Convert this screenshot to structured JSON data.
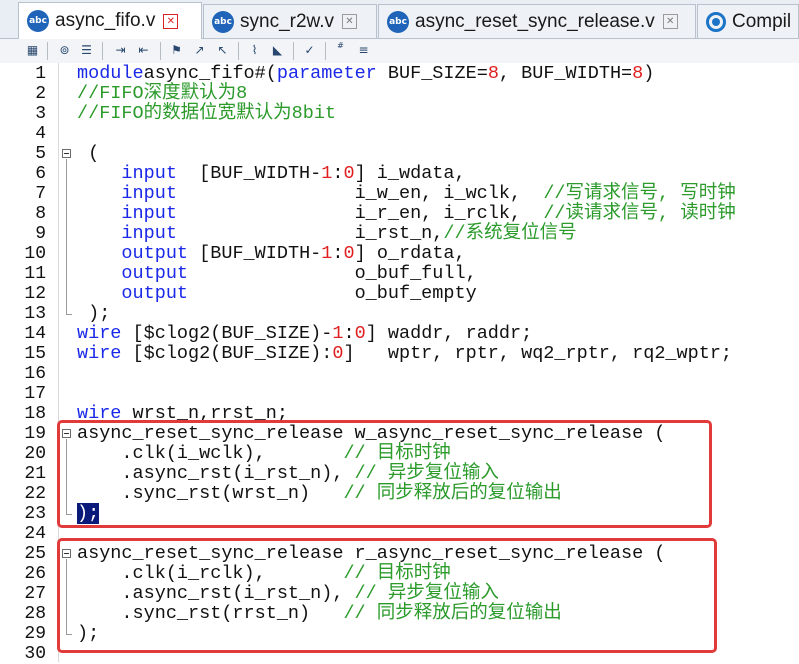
{
  "tabs": [
    {
      "label": "async_fifo.v",
      "icon": "abc-file-icon",
      "icon_text": "abc",
      "active": true
    },
    {
      "label": "sync_r2w.v",
      "icon": "abc-file-icon",
      "icon_text": "abc",
      "active": false
    },
    {
      "label": "async_reset_sync_release.v",
      "icon": "abc-file-icon",
      "icon_text": "abc",
      "active": false
    },
    {
      "label": "Compil",
      "icon": "compile-icon",
      "active": false
    }
  ],
  "colors": {
    "keyword": "#1a28e8",
    "number": "#e02020",
    "comment": "#2c9b2c",
    "selection": "#0a1a7a",
    "highlight_box": "#e03a3a"
  },
  "editor": {
    "lines": [
      {
        "n": "1",
        "code": [
          [
            "kw",
            "module"
          ],
          [
            "",
            "async_fifo#("
          ],
          [
            "kw",
            "parameter"
          ],
          [
            "",
            " BUF_SIZE="
          ],
          [
            "num",
            "8"
          ],
          [
            "",
            ", BUF_WIDTH="
          ],
          [
            "num",
            "8"
          ],
          [
            "",
            ")"
          ]
        ]
      },
      {
        "n": "2",
        "code": [
          [
            "cm",
            "//FIFO深度默认为8"
          ]
        ]
      },
      {
        "n": "3",
        "code": [
          [
            "cm",
            "//FIFO的数据位宽默认为8bit"
          ]
        ]
      },
      {
        "n": "4",
        "code": []
      },
      {
        "n": "5",
        "code": [
          [
            "",
            " ("
          ]
        ],
        "fold": true
      },
      {
        "n": "6",
        "code": [
          [
            "",
            "    "
          ],
          [
            "kw",
            "input"
          ],
          [
            "",
            "  [BUF_WIDTH-"
          ],
          [
            "num",
            "1"
          ],
          [
            "",
            ":"
          ],
          [
            "num",
            "0"
          ],
          [
            "",
            "] i_wdata,"
          ]
        ]
      },
      {
        "n": "7",
        "code": [
          [
            "",
            "    "
          ],
          [
            "kw",
            "input"
          ],
          [
            "",
            "                i_w_en, i_wclk,  "
          ],
          [
            "cm",
            "//写请求信号, 写时钟"
          ]
        ]
      },
      {
        "n": "8",
        "code": [
          [
            "",
            "    "
          ],
          [
            "kw",
            "input"
          ],
          [
            "",
            "                i_r_en, i_rclk,  "
          ],
          [
            "cm",
            "//读请求信号, 读时钟"
          ]
        ]
      },
      {
        "n": "9",
        "code": [
          [
            "",
            "    "
          ],
          [
            "kw",
            "input"
          ],
          [
            "",
            "                i_rst_n,"
          ],
          [
            "cm",
            "//系统复位信号"
          ]
        ]
      },
      {
        "n": "10",
        "code": [
          [
            "",
            "    "
          ],
          [
            "kw",
            "output"
          ],
          [
            "",
            " [BUF_WIDTH-"
          ],
          [
            "num",
            "1"
          ],
          [
            "",
            ":"
          ],
          [
            "num",
            "0"
          ],
          [
            "",
            "] o_rdata,"
          ]
        ]
      },
      {
        "n": "11",
        "code": [
          [
            "",
            "    "
          ],
          [
            "kw",
            "output"
          ],
          [
            "",
            "               o_buf_full,"
          ]
        ]
      },
      {
        "n": "12",
        "code": [
          [
            "",
            "    "
          ],
          [
            "kw",
            "output"
          ],
          [
            "",
            "               o_buf_empty"
          ]
        ]
      },
      {
        "n": "13",
        "code": [
          [
            "",
            " );"
          ]
        ]
      },
      {
        "n": "14",
        "code": [
          [
            "kw",
            "wire"
          ],
          [
            "",
            " [$clog2(BUF_SIZE)-"
          ],
          [
            "num",
            "1"
          ],
          [
            "",
            ":"
          ],
          [
            "num",
            "0"
          ],
          [
            "",
            "] waddr, raddr;"
          ]
        ]
      },
      {
        "n": "15",
        "code": [
          [
            "kw",
            "wire"
          ],
          [
            "",
            " [$clog2(BUF_SIZE):"
          ],
          [
            "num",
            "0"
          ],
          [
            "",
            "]   wptr, rptr, wq2_rptr, rq2_wptr;"
          ]
        ]
      },
      {
        "n": "16",
        "code": []
      },
      {
        "n": "17",
        "code": []
      },
      {
        "n": "18",
        "code": [
          [
            "kw",
            "wire"
          ],
          [
            "",
            " wrst_n,rrst_n;"
          ]
        ]
      },
      {
        "n": "19",
        "code": [
          [
            "",
            "async_reset_sync_release w_async_reset_sync_release ("
          ]
        ],
        "fold": true
      },
      {
        "n": "20",
        "code": [
          [
            "",
            "    .clk(i_wclk),       "
          ],
          [
            "cm",
            "// 目标时钟"
          ]
        ]
      },
      {
        "n": "21",
        "code": [
          [
            "",
            "    .async_rst(i_rst_n), "
          ],
          [
            "cm",
            "// 异步复位输入"
          ]
        ]
      },
      {
        "n": "22",
        "code": [
          [
            "",
            "    .sync_rst(wrst_n)   "
          ],
          [
            "cm",
            "// 同步释放后的复位输出"
          ]
        ]
      },
      {
        "n": "23",
        "code": [
          [
            "sel",
            ");"
          ]
        ]
      },
      {
        "n": "24",
        "code": []
      },
      {
        "n": "25",
        "code": [
          [
            "",
            "async_reset_sync_release r_async_reset_sync_release ("
          ]
        ],
        "fold": true
      },
      {
        "n": "26",
        "code": [
          [
            "",
            "    .clk(i_rclk),       "
          ],
          [
            "cm",
            "// 目标时钟"
          ]
        ]
      },
      {
        "n": "27",
        "code": [
          [
            "",
            "    .async_rst(i_rst_n), "
          ],
          [
            "cm",
            "// 异步复位输入"
          ]
        ]
      },
      {
        "n": "28",
        "code": [
          [
            "",
            "    .sync_rst(rrst_n)   "
          ],
          [
            "cm",
            "// 同步释放后的复位输出"
          ]
        ]
      },
      {
        "n": "29",
        "code": [
          [
            "",
            ");"
          ]
        ]
      },
      {
        "n": "30",
        "code": []
      }
    ]
  }
}
